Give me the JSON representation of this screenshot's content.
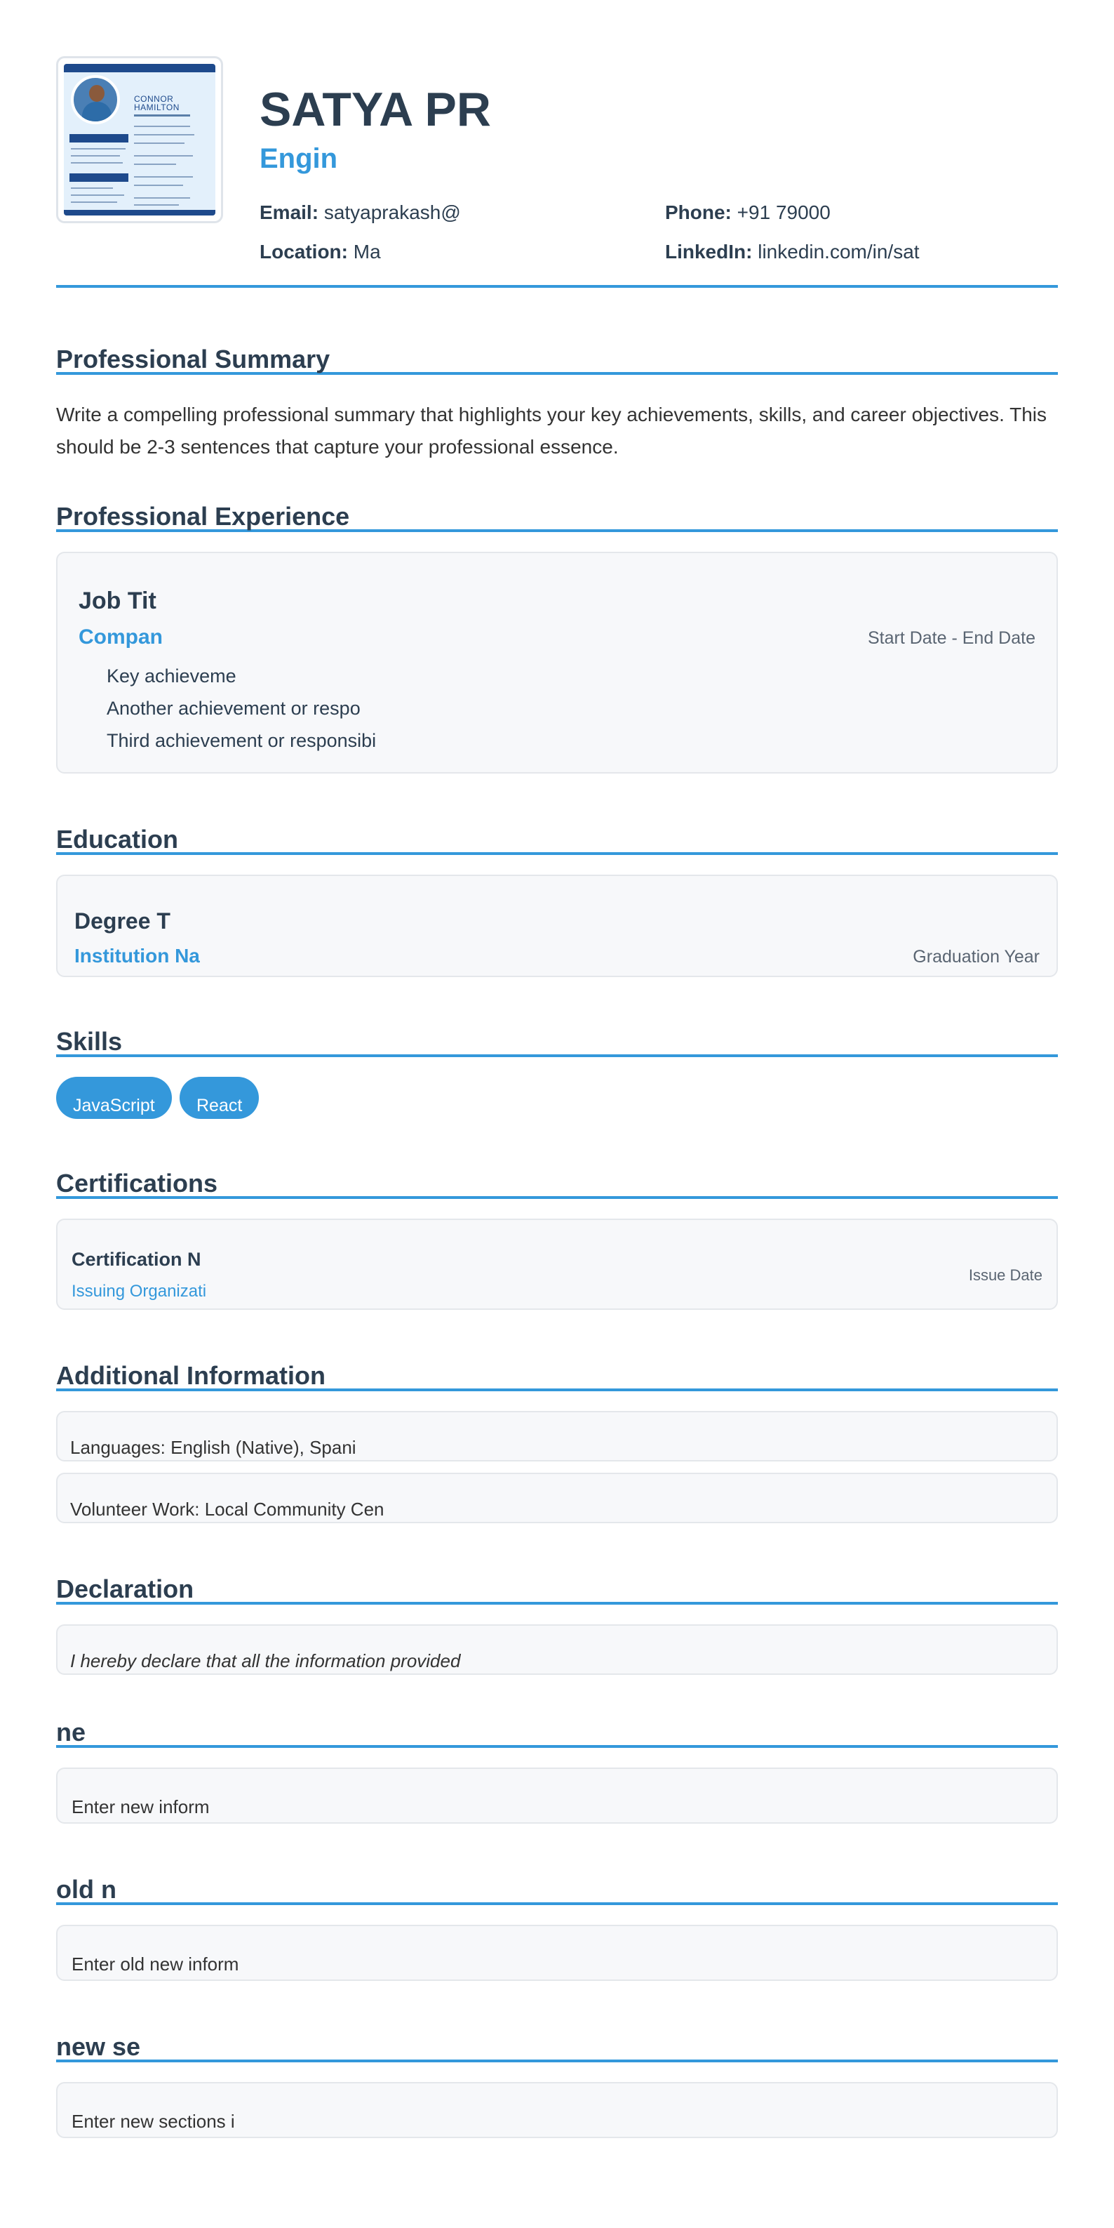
{
  "header": {
    "photo": {
      "thumb_name": "CONNOR\nHAMILTON"
    },
    "name": "SATYA PR",
    "title": "Engin",
    "contact": {
      "email_label": "Email:",
      "email": "satyaprakash@",
      "phone_label": "Phone:",
      "phone": "+91 79000",
      "location_label": "Location:",
      "location": "Ma",
      "linkedin_label": "LinkedIn:",
      "linkedin": "linkedin.com/in/sat"
    }
  },
  "summary": {
    "heading": "Professional Summary",
    "text": "Write a compelling professional summary that highlights your key achievements, skills, and career objectives. This should be 2-3 sentences that capture your professional essence."
  },
  "experience": {
    "heading": "Professional Experience",
    "items": [
      {
        "title": "Job Tit",
        "company": "Compan",
        "dates": "Start Date - End Date",
        "bullets": [
          "Key achieveme",
          "Another achievement or respo",
          "Third achievement or responsibi"
        ]
      }
    ]
  },
  "education": {
    "heading": "Education",
    "items": [
      {
        "degree": "Degree T",
        "institution": "Institution Na",
        "year": "Graduation Year"
      }
    ]
  },
  "skills": {
    "heading": "Skills",
    "items": [
      "JavaScript",
      "React"
    ]
  },
  "certifications": {
    "heading": "Certifications",
    "items": [
      {
        "name": "Certification N",
        "issuer": "Issuing Organizati",
        "date": "Issue Date"
      }
    ]
  },
  "additional": {
    "heading": "Additional Information",
    "items": [
      "Languages: English (Native), Spani",
      "Volunteer Work: Local Community Cen"
    ]
  },
  "declaration": {
    "heading": "Declaration",
    "text": "I hereby declare that all the information provided"
  },
  "custom_sections": [
    {
      "heading": "ne",
      "text": "Enter new inform"
    },
    {
      "heading": "old n",
      "text": "Enter old new inform"
    },
    {
      "heading": "new se",
      "text": "Enter new sections i"
    }
  ]
}
